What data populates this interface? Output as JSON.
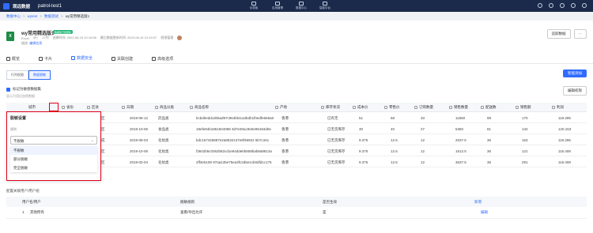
{
  "topbar": {
    "brand": "观远数据",
    "project": "patrol-test1",
    "modules": [
      "仪表板",
      "应用管理",
      "数据中心",
      "智能中台"
    ]
  },
  "breadcrumb": [
    "数据中心",
    "wytest",
    "数据测试",
    "wy常用精选版1"
  ],
  "dataset": {
    "title": "wy常用精选版1",
    "badge": "数据集已经更新",
    "meta": [
      "Excel",
      "4行",
      "17列",
      "创建时间: 2022-08-15 10:19:56",
      "最后数据更新时间: 2022-08-15 10:19:57",
      "权限管理"
    ],
    "desc_label": "描述:",
    "desc_value": "编辑信息"
  },
  "right_buttons": {
    "primary": "追踪数据",
    "more": "···"
  },
  "tabs": [
    "概览",
    "卡片",
    "数据安全",
    "关联创建",
    "高级选项"
  ],
  "active_tab": 2,
  "segments": [
    "行列权限",
    "数据脱敏"
  ],
  "active_segment": 1,
  "primary_button": "智能添加",
  "checkbox_label": "标记为敏感数据集",
  "checkbox_hint": "显示引用后加密数据",
  "edit_button": "编辑权限",
  "columns": [
    "城市",
    "省份",
    "区县",
    "日期",
    "商品分类",
    "商品名称",
    "产地",
    "库存状况",
    "成本价",
    "零售价",
    "订购数量",
    "销售数量",
    "配送数",
    "销售额",
    "利润"
  ],
  "rows": [
    [
      "",
      "",
      "区",
      "2019-06-12",
      "药品类",
      "bcbd0eddcd05ad97c964fd41a3bdb1f0edfe665a0",
      "香港",
      "已有无",
      "51",
      "68",
      "33",
      "11560",
      "99",
      "170",
      "119.295"
    ],
    [
      "",
      "",
      "区",
      "2019-10-06",
      "食品类",
      "19efe94b1861504088 3d7e30ac9e6e95184d0e",
      "香港",
      "已无货库存",
      "30",
      "40",
      "27",
      "5360",
      "81",
      "134",
      "120.153"
    ],
    [
      "",
      "",
      "成",
      "2019-08-03",
      "化妆类",
      "bdc167426887e2a8532137e8f36931 6b7c341",
      "香港",
      "已无货库存",
      "9.375",
      "12.5",
      "12",
      "2037.5",
      "36",
      "163",
      "119.295"
    ],
    [
      "",
      "",
      "区",
      "2019-10-06",
      "化妆类",
      "f3842b5c0362b82cd1e64ddebb858bab8a8813a",
      "香港",
      "已无货库存",
      "9.375",
      "12.5",
      "12",
      "1512.5",
      "36",
      "121",
      "116.408"
    ],
    [
      "",
      "",
      "区",
      "2019-02-04",
      "化妆类",
      "2ff3e5108 87aa135e75ea3fc2d5e1cb0dfd1c175",
      "香港",
      "已无货库存",
      "9.375",
      "12.5",
      "12",
      "3637.5",
      "36",
      "291",
      "116.408"
    ]
  ],
  "popover": {
    "title": "脱敏设置",
    "rule_label": "规则",
    "selected": "不脱敏",
    "options": [
      "不脱敏",
      "部分脱敏",
      "完全脱敏"
    ]
  },
  "bottom": {
    "title": "配置关联用户/用户组",
    "headers": [
      "用户名/用户",
      "脱敏规则",
      "是否生效",
      "新增"
    ],
    "rows": [
      [
        "1",
        "其他所有",
        "查看/导出允许",
        "是",
        "编辑"
      ]
    ]
  }
}
